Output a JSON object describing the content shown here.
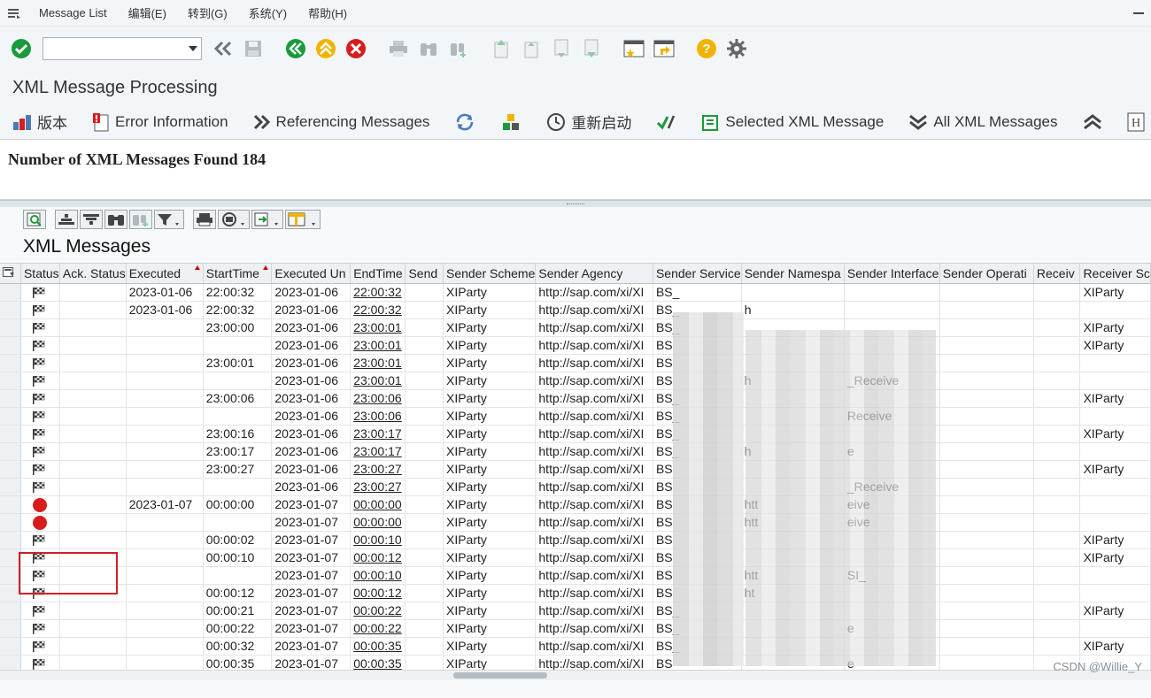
{
  "menu": {
    "items": [
      "Message List",
      "编辑(E)",
      "转到(G)",
      "系统(Y)",
      "帮助(H)"
    ]
  },
  "window": {
    "title": "XML Message Processing"
  },
  "app_toolbar": {
    "version": "版本",
    "error_info": "Error Information",
    "referencing": "Referencing Messages",
    "restart": "重新启动",
    "selected_xml": "Selected XML Message",
    "all_xml": "All XML Messages"
  },
  "header": {
    "found_text": "Number of XML Messages Found 184"
  },
  "list": {
    "title": "XML Messages",
    "columns": [
      "Status",
      "Ack. Status",
      "Executed",
      "StartTime",
      "Executed Un",
      "EndTime",
      "Send",
      "Sender Scheme",
      "Sender Agency",
      "Sender Service",
      "Sender Namespa",
      "Sender Interface",
      "Sender Operati",
      "Receiv",
      "Receiver Sc"
    ],
    "rows": [
      {
        "status": "flag",
        "executed": "2023-01-06",
        "start": "22:00:32",
        "exec_until": "2023-01-06",
        "end": "22:00:32",
        "scheme": "XIParty",
        "agency": "http://sap.com/xi/XI",
        "service": "BS_",
        "namespace": "",
        "interface": "",
        "receiver": "XIParty"
      },
      {
        "status": "flag",
        "executed": "2023-01-06",
        "start": "22:00:32",
        "exec_until": "2023-01-06",
        "end": "22:00:32",
        "scheme": "XIParty",
        "agency": "http://sap.com/xi/XI",
        "service": "BS_",
        "namespace": "h",
        "interface": "",
        "receiver": ""
      },
      {
        "status": "flag",
        "executed": "",
        "start": "23:00:00",
        "exec_until": "2023-01-06",
        "end": "23:00:01",
        "scheme": "XIParty",
        "agency": "http://sap.com/xi/XI",
        "service": "BS_",
        "namespace": "",
        "interface": "",
        "receiver": "XIParty"
      },
      {
        "status": "flag",
        "executed": "",
        "start": "",
        "exec_until": "2023-01-06",
        "end": "23:00:01",
        "scheme": "XIParty",
        "agency": "http://sap.com/xi/XI",
        "service": "BS",
        "namespace": "",
        "interface": "",
        "receiver": "XIParty"
      },
      {
        "status": "flag",
        "executed": "",
        "start": "23:00:01",
        "exec_until": "2023-01-06",
        "end": "23:00:01",
        "scheme": "XIParty",
        "agency": "http://sap.com/xi/XI",
        "service": "BS",
        "namespace": "",
        "interface": "",
        "receiver": ""
      },
      {
        "status": "flag",
        "executed": "",
        "start": "",
        "exec_until": "2023-01-06",
        "end": "23:00:01",
        "scheme": "XIParty",
        "agency": "http://sap.com/xi/XI",
        "service": "BS",
        "namespace": "h",
        "interface": "_Receive",
        "receiver": ""
      },
      {
        "status": "flag",
        "executed": "",
        "start": "23:00:06",
        "exec_until": "2023-01-06",
        "end": "23:00:06",
        "scheme": "XIParty",
        "agency": "http://sap.com/xi/XI",
        "service": "BS_",
        "namespace": "",
        "interface": "",
        "receiver": "XIParty"
      },
      {
        "status": "flag",
        "executed": "",
        "start": "",
        "exec_until": "2023-01-06",
        "end": "23:00:06",
        "scheme": "XIParty",
        "agency": "http://sap.com/xi/XI",
        "service": "BS_",
        "namespace": "",
        "interface": "Receive",
        "receiver": ""
      },
      {
        "status": "flag",
        "executed": "",
        "start": "23:00:16",
        "exec_until": "2023-01-06",
        "end": "23:00:17",
        "scheme": "XIParty",
        "agency": "http://sap.com/xi/XI",
        "service": "BS_",
        "namespace": "",
        "interface": "",
        "receiver": "XIParty"
      },
      {
        "status": "flag",
        "executed": "",
        "start": "23:00:17",
        "exec_until": "2023-01-06",
        "end": "23:00:17",
        "scheme": "XIParty",
        "agency": "http://sap.com/xi/XI",
        "service": "BS_",
        "namespace": "h",
        "interface": "e",
        "receiver": ""
      },
      {
        "status": "flag",
        "executed": "",
        "start": "23:00:27",
        "exec_until": "2023-01-06",
        "end": "23:00:27",
        "scheme": "XIParty",
        "agency": "http://sap.com/xi/XI",
        "service": "BS",
        "namespace": "",
        "interface": "",
        "receiver": "XIParty"
      },
      {
        "status": "flag",
        "executed": "",
        "start": "",
        "exec_until": "2023-01-06",
        "end": "23:00:27",
        "scheme": "XIParty",
        "agency": "http://sap.com/xi/XI",
        "service": "BS",
        "namespace": "",
        "interface": "_Receive",
        "receiver": ""
      },
      {
        "status": "error",
        "executed": "2023-01-07",
        "start": "00:00:00",
        "exec_until": "2023-01-07",
        "end": "00:00:00",
        "scheme": "XIParty",
        "agency": "http://sap.com/xi/XI",
        "service": "BS",
        "namespace": "htt",
        "interface": "eive",
        "receiver": ""
      },
      {
        "status": "error",
        "executed": "",
        "start": "",
        "exec_until": "2023-01-07",
        "end": "00:00:00",
        "scheme": "XIParty",
        "agency": "http://sap.com/xi/XI",
        "service": "BS",
        "namespace": "htt",
        "interface": "eive",
        "receiver": ""
      },
      {
        "status": "flag",
        "executed": "",
        "start": "00:00:02",
        "exec_until": "2023-01-07",
        "end": "00:00:10",
        "scheme": "XIParty",
        "agency": "http://sap.com/xi/XI",
        "service": "BS",
        "namespace": "",
        "interface": "",
        "receiver": "XIParty"
      },
      {
        "status": "flag",
        "executed": "",
        "start": "00:00:10",
        "exec_until": "2023-01-07",
        "end": "00:00:12",
        "scheme": "XIParty",
        "agency": "http://sap.com/xi/XI",
        "service": "BS",
        "namespace": "",
        "interface": "",
        "receiver": "XIParty"
      },
      {
        "status": "flag",
        "executed": "",
        "start": "",
        "exec_until": "2023-01-07",
        "end": "00:00:10",
        "scheme": "XIParty",
        "agency": "http://sap.com/xi/XI",
        "service": "BS",
        "namespace": "htt",
        "interface": "SI_",
        "receiver": ""
      },
      {
        "status": "flag",
        "executed": "",
        "start": "00:00:12",
        "exec_until": "2023-01-07",
        "end": "00:00:12",
        "scheme": "XIParty",
        "agency": "http://sap.com/xi/XI",
        "service": "BS",
        "namespace": "ht",
        "interface": "",
        "receiver": ""
      },
      {
        "status": "flag",
        "executed": "",
        "start": "00:00:21",
        "exec_until": "2023-01-07",
        "end": "00:00:22",
        "scheme": "XIParty",
        "agency": "http://sap.com/xi/XI",
        "service": "BS_",
        "namespace": "",
        "interface": "",
        "receiver": "XIParty"
      },
      {
        "status": "flag",
        "executed": "",
        "start": "00:00:22",
        "exec_until": "2023-01-07",
        "end": "00:00:22",
        "scheme": "XIParty",
        "agency": "http://sap.com/xi/XI",
        "service": "BS_",
        "namespace": "",
        "interface": "e",
        "receiver": ""
      },
      {
        "status": "flag",
        "executed": "",
        "start": "00:00:32",
        "exec_until": "2023-01-07",
        "end": "00:00:35",
        "scheme": "XIParty",
        "agency": "http://sap.com/xi/XI",
        "service": "BS_",
        "namespace": "",
        "interface": "",
        "receiver": "XIParty"
      },
      {
        "status": "flag",
        "executed": "",
        "start": "00:00:35",
        "exec_until": "2023-01-07",
        "end": "00:00:35",
        "scheme": "XIParty",
        "agency": "http://sap.com/xi/XI",
        "service": "BS_",
        "namespace": "",
        "interface": "e",
        "receiver": ""
      }
    ]
  },
  "watermark": "CSDN @Willie_Y",
  "colors": {
    "error": "#d81c1c",
    "highlight": "#d0202a",
    "accent_green": "#1a9a3a",
    "accent_yellow": "#f0b400"
  }
}
